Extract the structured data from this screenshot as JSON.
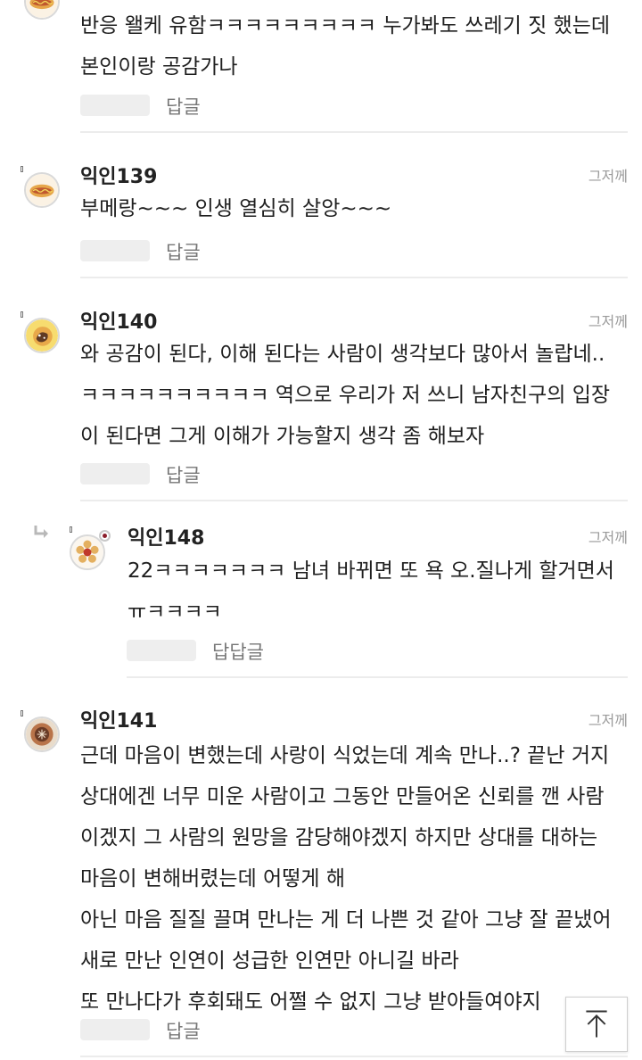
{
  "comments": [
    {
      "nickname": "",
      "time": "",
      "lines": [
        "반응 왤케 유함ㅋㅋㅋㅋㅋㅋㅋㅋㅋ 누가봐도 쓰레기 짓 했는데",
        "본인이랑 공감가나"
      ],
      "reply_label": "답글"
    },
    {
      "nickname": "익인139",
      "time": "그저께",
      "lines": [
        "부메랑~~~ 인생 열심히 살앙~~~"
      ],
      "reply_label": "답글"
    },
    {
      "nickname": "익인140",
      "time": "그저께",
      "lines": [
        "와 공감이 된다, 이해 된다는 사람이 생각보다 많아서 놀랍네..",
        "ㅋㅋㅋㅋㅋㅋㅋㅋㅋㅋ 역으로 우리가 저 쓰니 남자친구의 입장",
        "이 된다면 그게 이해가 가능할지 생각 좀 해보자"
      ],
      "reply_label": "답글"
    },
    {
      "nickname": "익인148",
      "time": "그저께",
      "lines": [
        "22ㅋㅋㅋㅋㅋㅋㅋ 남녀 바뀌면 또 욕 오.질나게 할거면서",
        "ㅠㅋㅋㅋㅋ"
      ],
      "reply_label": "답답글"
    },
    {
      "nickname": "익인141",
      "time": "그저께",
      "lines": [
        "근데 마음이 변했는데 사랑이 식었는데 계속 만나..? 끝난 거지",
        "상대에겐 너무 미운 사람이고 그동안 만들어온 신뢰를 깬 사람",
        "이겠지 그 사람의 원망을 감당해야겠지 하지만 상대를 대하는",
        "마음이 변해버렸는데 어떻게 해",
        "아닌 마음 질질 끌며 만나는 게 더 나쁜 것 같아 그냥 잘 끝냈어",
        "새로 만난 인연이 성급한 인연만 아니길 바라",
        "또 만나다가 후회돼도 어쩔 수 없지 그냥 받아들여야지"
      ],
      "reply_label": "답글"
    }
  ],
  "scroll_top_icon": "arrow-up-to-line-icon",
  "icons": {
    "reply_indicator": "reply-arrow-icon"
  },
  "colors": {
    "text": "#1f1f1f",
    "meta": "#9a9a9a",
    "reply_label": "#777777",
    "divider": "#ececec",
    "placeholder": "#eeeeee"
  }
}
